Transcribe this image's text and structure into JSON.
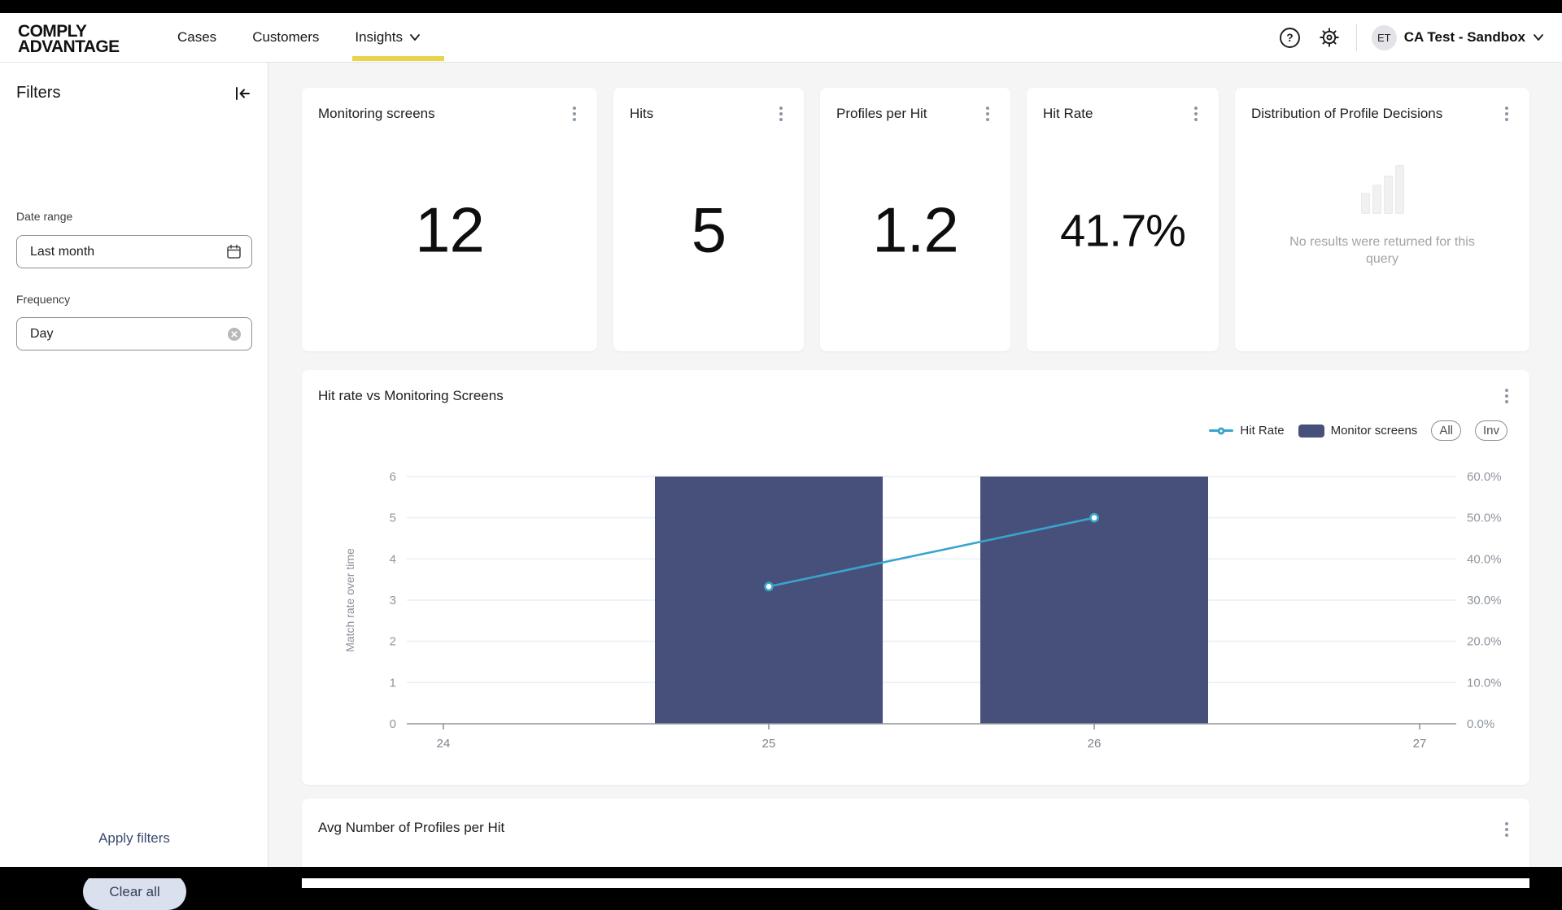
{
  "colors": {
    "accent_yellow": "#e9d44f",
    "bar_navy": "#474f7b",
    "line_cyan": "#39a5cc",
    "page_bg": "#f5f5f6",
    "clear_btn_bg": "#dbe0ee",
    "apply_link": "#3b4a6e"
  },
  "header": {
    "logo_line1": "COMPLY",
    "logo_line2": "ADVANTAGE",
    "nav": [
      {
        "label": "Cases"
      },
      {
        "label": "Customers"
      },
      {
        "label": "Insights",
        "active": true,
        "has_dropdown": true
      }
    ],
    "icons": {
      "help": "question-circle",
      "settings": "gear"
    },
    "account": {
      "avatar_initials": "ET",
      "name": "CA Test - Sandbox"
    }
  },
  "sidebar": {
    "title": "Filters",
    "collapse_icon": "collapse-left",
    "fields": [
      {
        "label": "Date range",
        "value": "Last month",
        "icon": "calendar"
      },
      {
        "label": "Frequency",
        "value": "Day",
        "icon": "clear-circle"
      }
    ],
    "apply_label": "Apply filters",
    "clear_label": "Clear all"
  },
  "stat_cards": [
    {
      "title": "Monitoring screens",
      "value": "12"
    },
    {
      "title": "Hits",
      "value": "5"
    },
    {
      "title": "Profiles per Hit",
      "value": "1.2"
    },
    {
      "title": "Hit Rate",
      "value": "41.7%"
    },
    {
      "title": "Distribution of Profile Decisions",
      "empty_message": "No results were returned for this query",
      "empty_icon": "ascending-bars"
    }
  ],
  "chart_card": {
    "title": "Hit rate vs Monitoring Screens",
    "legend": [
      {
        "label": "Hit Rate",
        "type": "line",
        "color": "#39a5cc"
      },
      {
        "label": "Monitor screens",
        "type": "bar",
        "color": "#474f7b"
      }
    ],
    "buttons": [
      "All",
      "Inv"
    ]
  },
  "chart_data": {
    "type": "bar",
    "subtype": "bar+line dual-axis",
    "title": "Hit rate vs Monitoring Screens",
    "x": [
      24,
      25,
      26,
      27
    ],
    "series": [
      {
        "name": "Monitor screens",
        "type": "bar",
        "axis": "left",
        "color": "#474f7b",
        "points": [
          {
            "x": 25,
            "y": 6
          },
          {
            "x": 26,
            "y": 6
          }
        ]
      },
      {
        "name": "Hit Rate",
        "type": "line",
        "axis": "right",
        "color": "#39a5cc",
        "points": [
          {
            "x": 25,
            "y": 33.3
          },
          {
            "x": 26,
            "y": 50.0
          }
        ]
      }
    ],
    "left_axis": {
      "label": "Match rate over time",
      "min": 0,
      "max": 6,
      "ticks": [
        0,
        1,
        2,
        3,
        4,
        5,
        6
      ]
    },
    "right_axis": {
      "min": 0,
      "max": 60,
      "tick_labels": [
        "0.0%",
        "10.0%",
        "20.0%",
        "30.0%",
        "40.0%",
        "50.0%",
        "60.0%"
      ]
    },
    "grid": true,
    "legend_position": "top-right"
  },
  "bottom_card": {
    "title": "Avg Number of Profiles per Hit"
  }
}
